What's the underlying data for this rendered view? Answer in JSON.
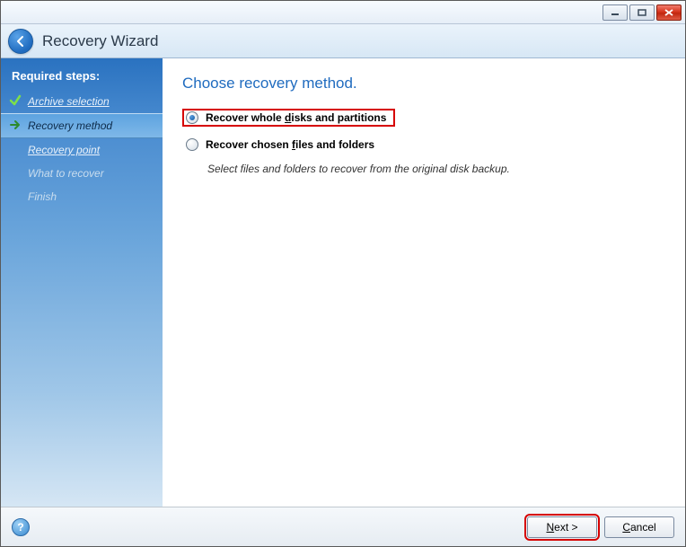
{
  "header": {
    "title": "Recovery Wizard"
  },
  "sidebar": {
    "heading": "Required steps:",
    "steps": [
      {
        "label": "Archive selection",
        "state": "done"
      },
      {
        "label": "Recovery method",
        "state": "current"
      },
      {
        "label": "Recovery point",
        "state": "next"
      },
      {
        "label": "What to recover",
        "state": "future"
      },
      {
        "label": "Finish",
        "state": "future"
      }
    ]
  },
  "main": {
    "title": "Choose recovery method.",
    "options": [
      {
        "label_prefix": "Recover whole ",
        "label_accel": "d",
        "label_suffix": "isks and partitions",
        "selected": true,
        "highlighted": true
      },
      {
        "label_prefix": "Recover chosen ",
        "label_accel": "f",
        "label_suffix": "iles and folders",
        "selected": false,
        "description": "Select files and folders to recover from the original disk backup."
      }
    ]
  },
  "footer": {
    "next_accel": "N",
    "next_suffix": "ext >",
    "cancel_accel": "C",
    "cancel_suffix": "ancel"
  }
}
